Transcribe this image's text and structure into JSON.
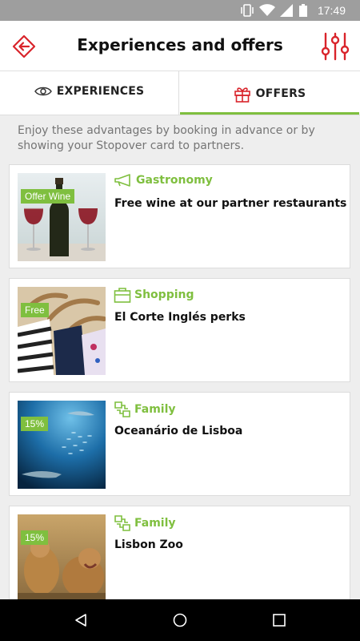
{
  "status_bar": {
    "time": "17:49",
    "icons": [
      "vibrate-icon",
      "wifi-icon",
      "signal-icon",
      "battery-icon"
    ]
  },
  "app_bar": {
    "title": "Experiences and offers",
    "back_icon": "back-arrow-icon",
    "filter_icon": "filter-sliders-icon"
  },
  "tabs": [
    {
      "label": "EXPERIENCES",
      "icon": "eye-icon",
      "selected": false
    },
    {
      "label": "OFFERS",
      "icon": "gift-icon",
      "selected": true
    }
  ],
  "intro": "Enjoy these advantages by booking in advance or by showing your Stopover card to partners.",
  "offers": [
    {
      "badge": "Offer Wine",
      "category": "Gastronomy",
      "category_icon": "megaphone-icon",
      "title": "Free wine at our partner restaurants"
    },
    {
      "badge": "Free",
      "category": "Shopping",
      "category_icon": "shopping-bag-icon",
      "title": "El Corte Inglés perks"
    },
    {
      "badge": "15%",
      "category": "Family",
      "category_icon": "family-icon",
      "title": "Oceanário de Lisboa"
    },
    {
      "badge": "15%",
      "category": "Family",
      "category_icon": "family-icon",
      "title": "Lisbon Zoo"
    }
  ],
  "colors": {
    "accent_green": "#7fbf3f",
    "accent_red": "#d9242b",
    "status_bar": "#9e9e9e"
  }
}
